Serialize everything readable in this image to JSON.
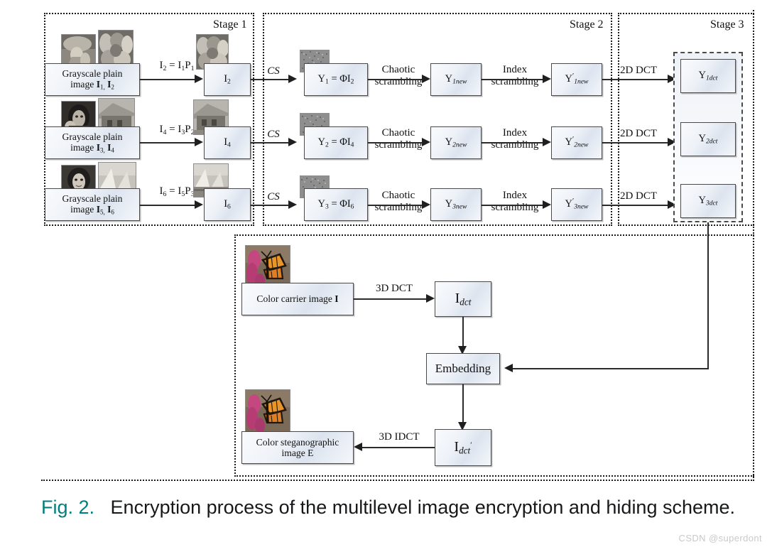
{
  "figure": {
    "stages": [
      {
        "id": "stage1",
        "label": "Stage 1"
      },
      {
        "id": "stage2",
        "label": "Stage 2"
      },
      {
        "id": "stage3",
        "label": "Stage 3"
      }
    ],
    "stage1": {
      "rows": [
        {
          "source_label_line1": "Grayscale plain",
          "source_label_line2": "image I1, I2",
          "arrow_label": "I2 = I1P1",
          "result_label": "I2"
        },
        {
          "source_label_line1": "Grayscale plain",
          "source_label_line2": "image I3, I4",
          "arrow_label": "I4 = I3P2",
          "result_label": "I4"
        },
        {
          "source_label_line1": "Grayscale plain",
          "source_label_line2": "image I5, I6",
          "arrow_label": "I6 = I5P3",
          "result_label": "I6"
        }
      ]
    },
    "stage2": {
      "cs_label": "CS",
      "rows": [
        {
          "cs_box": "Y1 = ΦI2",
          "chaotic_label": "Chaotic\nscrambling",
          "ynew": "Y1new",
          "index_label": "Index\nscrambling",
          "ynew_prime": "Y'1new",
          "dct_label": "2D DCT"
        },
        {
          "cs_box": "Y2 = ΦI4",
          "chaotic_label": "Chaotic\nscrambling",
          "ynew": "Y2new",
          "index_label": "Index\nscrambling",
          "ynew_prime": "Y'2new",
          "dct_label": "2D DCT"
        },
        {
          "cs_box": "Y3 = ΦI6",
          "chaotic_label": "Chaotic\nscrambling",
          "ynew": "Y3new",
          "index_label": "Index\nscrambling",
          "ynew_prime": "Y'3new",
          "dct_label": "2D DCT"
        }
      ]
    },
    "stage3": {
      "boxes": [
        "Y1dct",
        "Y2dct",
        "Y3dct"
      ]
    },
    "hiding": {
      "carrier_label": "Color carrier image I",
      "carrier_arrow_label": "3D DCT",
      "idct_box": "Idct",
      "embedding_box": "Embedding",
      "idct_prime_box": "Idct'",
      "output_arrow_label": "3D IDCT",
      "output_label_line1": "Color steganographic",
      "output_label_line2": "image E"
    }
  },
  "caption": {
    "fig_number": "Fig. 2.",
    "text": "Encryption process of the multilevel image encryption and hiding scheme."
  },
  "watermark": {
    "text": "CSDN @superdont"
  },
  "colors": {
    "fig_number": "#00807c",
    "box_border": "#4a4a4a",
    "line": "#2b2b2b",
    "watermark": "#c9c9c9"
  }
}
